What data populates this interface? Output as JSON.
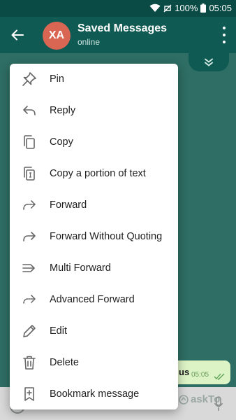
{
  "status_bar": {
    "battery_text": "100%",
    "time": "05:05",
    "wifi_icon": "wifi-icon",
    "battery_icon": "battery-icon"
  },
  "header": {
    "avatar_initials": "XA",
    "title": "Saved Messages",
    "subtitle": "online",
    "back_icon": "arrow-left-icon",
    "more_icon": "more-vertical-icon",
    "collapse_icon": "double-chevron-down-icon"
  },
  "colors": {
    "header_bg": "#0f5a52",
    "status_bg": "#0b4b45",
    "avatar_bg": "#d96652",
    "bubble_bg": "#dcf3c5"
  },
  "context_menu": {
    "items": [
      {
        "label": "Pin",
        "icon": "pin-icon"
      },
      {
        "label": "Reply",
        "icon": "reply-icon"
      },
      {
        "label": "Copy",
        "icon": "copy-icon"
      },
      {
        "label": "Copy a portion of text",
        "icon": "copy-portion-icon"
      },
      {
        "label": "Forward",
        "icon": "forward-icon"
      },
      {
        "label": "Forward Without Quoting",
        "icon": "forward-no-quote-icon"
      },
      {
        "label": "Multi Forward",
        "icon": "multi-forward-icon"
      },
      {
        "label": "Advanced Forward",
        "icon": "advanced-forward-icon"
      },
      {
        "label": "Edit",
        "icon": "pencil-icon"
      },
      {
        "label": "Delete",
        "icon": "trash-icon"
      },
      {
        "label": "Bookmark message",
        "icon": "bookmark-add-icon"
      }
    ]
  },
  "message": {
    "text_fragment": "us",
    "time": "05:05",
    "status_icon": "double-check-icon"
  },
  "input_bar": {
    "emoji_icon": "emoji-icon",
    "mic_icon": "mic-icon",
    "watermark_text": "askTo"
  }
}
